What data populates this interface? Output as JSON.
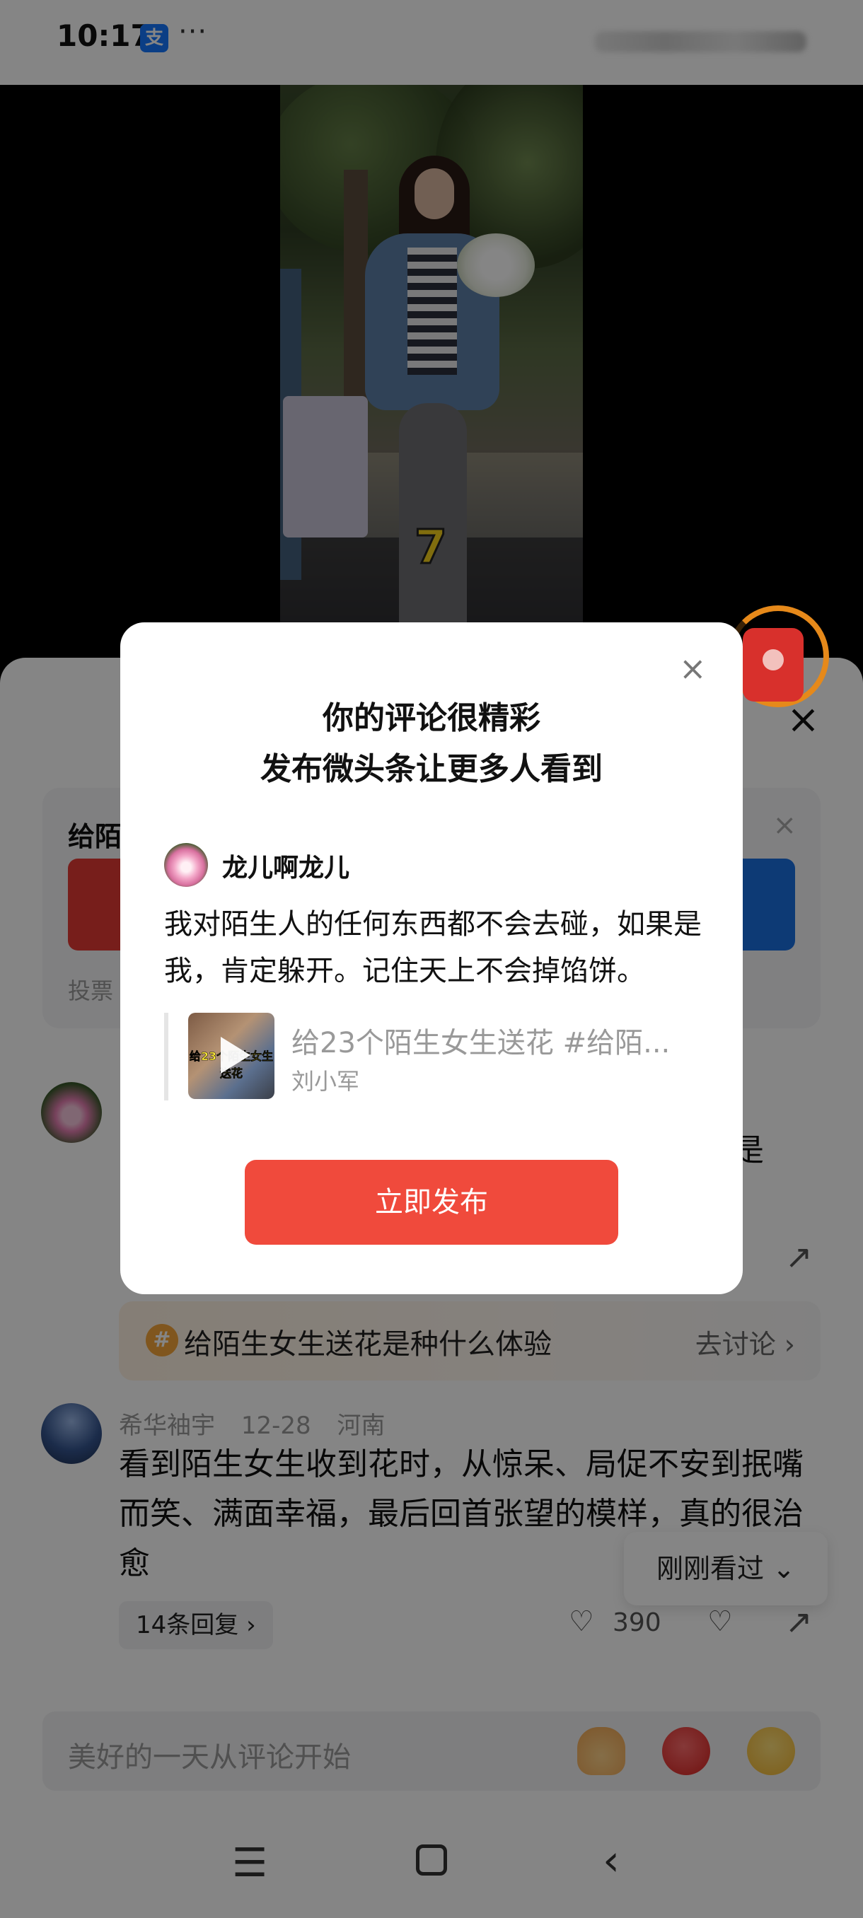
{
  "status_bar": {
    "time": "10:17",
    "app_badge": "支",
    "more": "···"
  },
  "video": {
    "overlay_number": "7"
  },
  "sheet": {
    "close_icon": "×",
    "vote_card": {
      "title": "给陌",
      "meta": "投票",
      "close_icon": "×"
    },
    "comment1": {
      "tail_char": "是",
      "share_icon": "share-icon"
    },
    "topic": {
      "icon": "#",
      "text": "给陌生女生送花是种什么体验",
      "action": "去讨论 ›"
    },
    "comment2": {
      "author": "希华袖宇",
      "date": "12-28",
      "location": "河南",
      "text": "看到陌生女生收到花时，从惊呆、局促不安到抿嘴而笑、满面幸福，最后回首张望的模样，真的很治愈",
      "replies_label": "14条回复 ›",
      "like_count": "390"
    },
    "recently_viewed": "刚刚看过 ⌄",
    "input_placeholder": "美好的一天从评论开始",
    "emojis": [
      "pray-emoji",
      "angry-emoji",
      "cry-emoji"
    ]
  },
  "dialog": {
    "close_icon": "×",
    "title_line1": "你的评论很精彩",
    "title_line2": "发布微头条让更多人看到",
    "username": "龙儿啊龙儿",
    "comment_text": "我对陌生人的任何东西都不会去碰，如果是我，肯定躲开。记住天上不会掉馅饼。",
    "quote": {
      "thumb_text": "给23个陌生女生送花",
      "title": "给23个陌生女生送花 #给陌...",
      "author": "刘小军"
    },
    "publish_button": "立即发布"
  },
  "colors": {
    "accent_red": "#f04a3c",
    "vote_red": "#e43a35",
    "vote_blue": "#1a6fe0",
    "overlay": "rgba(0,0,0,0.48)"
  }
}
